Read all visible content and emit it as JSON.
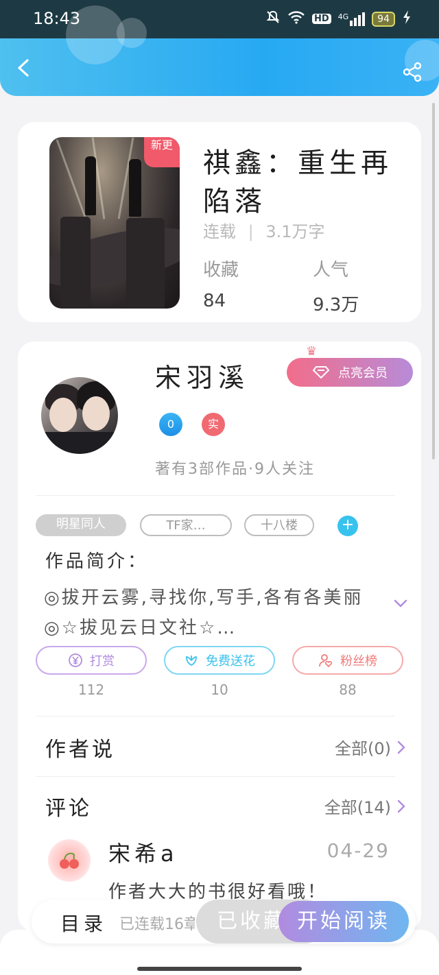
{
  "status_bar": {
    "time": "18:43",
    "hd_label": "HD",
    "network_label": "4G",
    "battery": "94"
  },
  "book": {
    "title": "祺鑫：重生再陷落",
    "cover_badge": "新更",
    "status": "连载",
    "word_count": "3.1万字",
    "favorites_label": "收藏",
    "favorites_value": "84",
    "popularity_label": "人气",
    "popularity_value": "9.3万"
  },
  "author": {
    "name": "宋羽溪",
    "vip_label": "点亮会员",
    "badge_1": "0",
    "badge_2": "实",
    "works_line": "著有3部作品·9人关注"
  },
  "tags": [
    "明星同人",
    "TF家…",
    "十八楼"
  ],
  "intro": {
    "label": "作品简介：",
    "text": "◎拔开云雾,寻找你,写手,各有各美丽◎☆拔见云日文社☆…"
  },
  "actions": [
    {
      "label": "打赏",
      "count": "112",
      "color": "#b18be0"
    },
    {
      "label": "免费送花",
      "count": "10",
      "color": "#38c2ee"
    },
    {
      "label": "粉丝榜",
      "count": "88",
      "color": "#f07a7a"
    }
  ],
  "author_says": {
    "title": "作者说",
    "link": "全部(0)"
  },
  "comments": {
    "title": "评论",
    "link": "全部(14)",
    "items": [
      {
        "user": "宋希a",
        "date": "04-29",
        "text": "作者大大的书很好看哦！"
      }
    ]
  },
  "bottom_bar": {
    "toc": "目录",
    "serial_status": "已连载16章",
    "collected": "已收藏",
    "read": "开始阅读"
  },
  "colors": {
    "header_blue": "#27a9f2",
    "accent_purple": "#b18be0",
    "accent_pink": "#f26d8a"
  }
}
